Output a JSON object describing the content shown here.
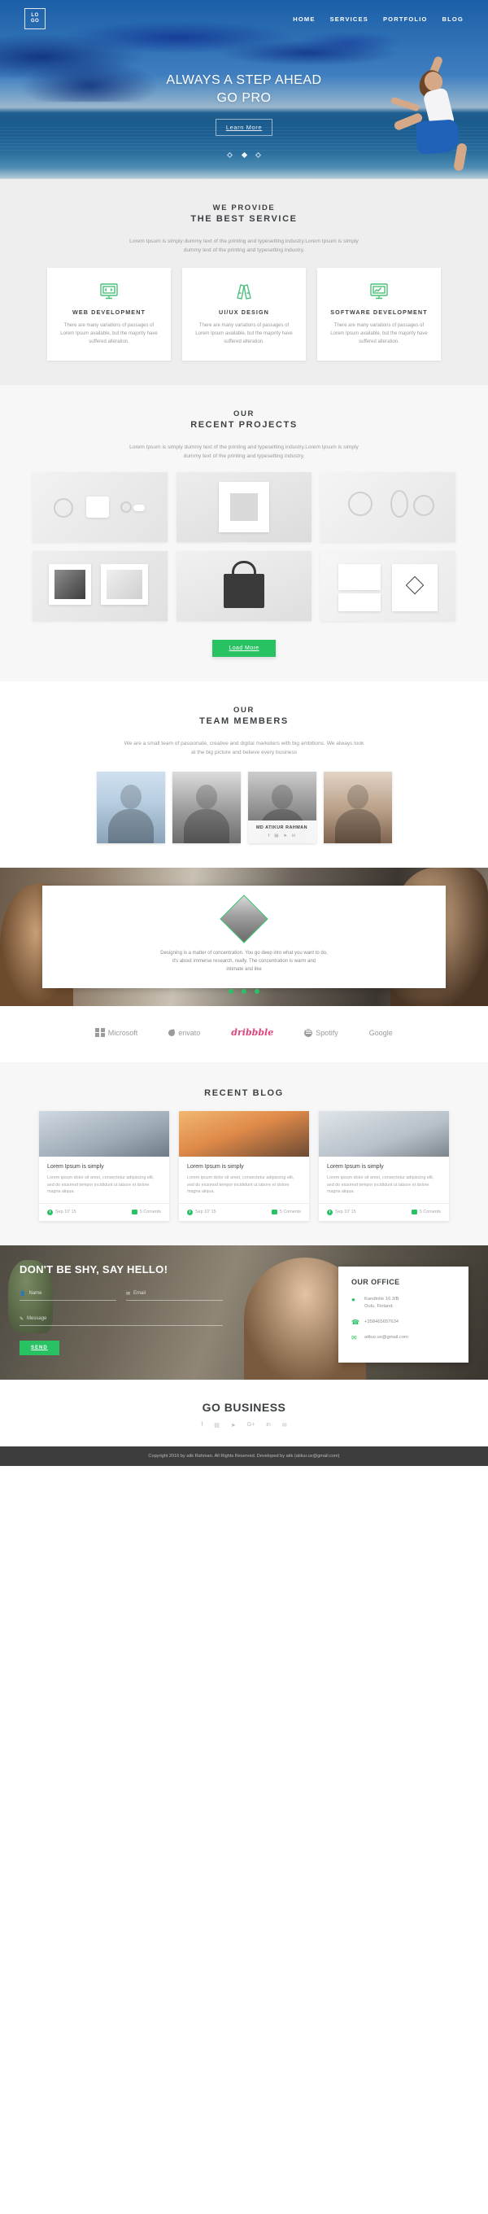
{
  "nav": {
    "logo_line1": "LO",
    "logo_line2": "GO",
    "items": [
      "HOME",
      "SERVICES",
      "PORTFOLIO",
      "BLOG"
    ]
  },
  "hero": {
    "title_line1": "ALWAYS A STEP AHEAD",
    "title_line2": "GO PRO",
    "cta": "Learn More",
    "dots": 3,
    "active_dot": 2
  },
  "services": {
    "heading_1": "WE PROVIDE",
    "heading_2": "THE BEST SERVICE",
    "subtitle": "Lorem Ipsum is simply dummy text of the printing and typesetting industry.Lorem Ipsum is simply dummy text of the printing and typesetting industry.",
    "cards": [
      {
        "icon": "code-monitor-icon",
        "title": "WEB DEVELOPMENT",
        "text": "There are many variations of passages of Lorem Ipsum available, but the majority have suffered alteration."
      },
      {
        "icon": "pencil-ruler-icon",
        "title": "UI/UX DESIGN",
        "text": "There are many variations of passages of Lorem Ipsum available, but the majority have suffered alteration."
      },
      {
        "icon": "chart-monitor-icon",
        "title": "SOFTWARE DEVELOPMENT",
        "text": "There are many variations of passages of Lorem Ipsum available, but the majority have suffered alteration."
      }
    ]
  },
  "projects": {
    "heading_1": "OUR",
    "heading_2": "RECENT PROJECTS",
    "subtitle": "Lorem Ipsum is simply dummy text of the printing and typesetting industry.Lorem Ipsum is simply dummy text of the printing and typesetting industry.",
    "tiles": [
      "earphones-product",
      "poster-mockup",
      "headphones-product",
      "photo-frames",
      "black-tote-bag",
      "business-card-set"
    ],
    "load_more": "Load More"
  },
  "team": {
    "heading_1": "OUR",
    "heading_2": "TEAM MEMBERS",
    "subtitle": "We are a small team of passionate, creative and digital marketers with big ambitions. We always look at the big picture and believe every business",
    "members": [
      {
        "name": "",
        "highlighted": false
      },
      {
        "name": "",
        "highlighted": false
      },
      {
        "name": "MD ATIKUR RAHMAN",
        "highlighted": true,
        "social": [
          "f",
          "▤",
          "➤",
          "in"
        ]
      },
      {
        "name": "",
        "highlighted": false
      }
    ]
  },
  "testimonial": {
    "avatar": "woman-portrait-diamond",
    "quote_line1": "Designing is a matter of concentration. You go deep into what you want to do,",
    "quote_line2": "it's about immerse research, really. The concentration is warm and",
    "quote_line3": "intimate and like",
    "dots": 3,
    "active_dots": [
      0,
      1,
      2
    ]
  },
  "clients": [
    {
      "name": "Microsoft",
      "icon": "microsoft-squares-icon",
      "color": "#9b9b9b"
    },
    {
      "name": "envato",
      "icon": "envato-leaf-icon",
      "color": "#9b9b9b"
    },
    {
      "name": "dribbble",
      "icon": "dribbble-wordmark",
      "color": "#e0447d"
    },
    {
      "name": "Spotify",
      "icon": "spotify-circle-icon",
      "color": "#9b9b9b"
    },
    {
      "name": "Google",
      "icon": "google-wordmark",
      "color": "#9b9b9b"
    }
  ],
  "blog": {
    "heading": "RECENT BLOG",
    "posts": [
      {
        "image": "two-men-laptop-outdoor",
        "title": "Lorem Ipsum is simply",
        "text": "Lorem ipsum dolor sit amet, consectetur adipiscing elit, sed do eiusmod tempor incididunt ut labore et dolore magna aliqua.",
        "date": "Sep 10' 15",
        "comments": "5 Coments"
      },
      {
        "image": "woman-sunset-jump",
        "title": "Lorem Ipsum is simply",
        "text": "Lorem ipsum dolor sit amet, consectetur adipiscing elit, sed do eiusmod tempor incididunt ut labore et dolore magna aliqua.",
        "date": "Sep 10' 15",
        "comments": "5 Coments"
      },
      {
        "image": "business-team-meeting",
        "title": "Lorem Ipsum is simply",
        "text": "Lorem ipsum dolor sit amet, consectetur adipiscing elit, sed do eiusmod tempor incididunt ut labore et dolore magna aliqua.",
        "date": "Sep 10' 15",
        "comments": "5 Coments"
      }
    ]
  },
  "contact": {
    "title": "DON'T BE SHY, SAY HELLO!",
    "fields": {
      "name_placeholder": "Name",
      "email_placeholder": "Email",
      "message_placeholder": "Message"
    },
    "submit": "SEND",
    "office": {
      "heading": "OUR OFFICE",
      "address_line1": "Kandintie 16 3/B",
      "address_line2": "Oulu,  Finland",
      "phone": "+358465657634",
      "email": "atikur.ux@gmail.com",
      "icons": [
        "location-pin-icon",
        "phone-icon",
        "envelope-icon"
      ]
    }
  },
  "footer": {
    "brand": "GO BUSINESS",
    "social": [
      "f",
      "▤",
      "➤",
      "G+",
      "in",
      "✉"
    ],
    "copyright": "Copyright 2016 by atik Rahman. All Rights Reserved. Developed by atik (atikur.ux@gmail.com)"
  },
  "colors": {
    "accent_green": "#28c263",
    "dribbble_pink": "#e0447d",
    "heading_dark": "#3c4043",
    "body_grey": "#9a9a9a",
    "footer_bar": "#3d3d3d"
  }
}
